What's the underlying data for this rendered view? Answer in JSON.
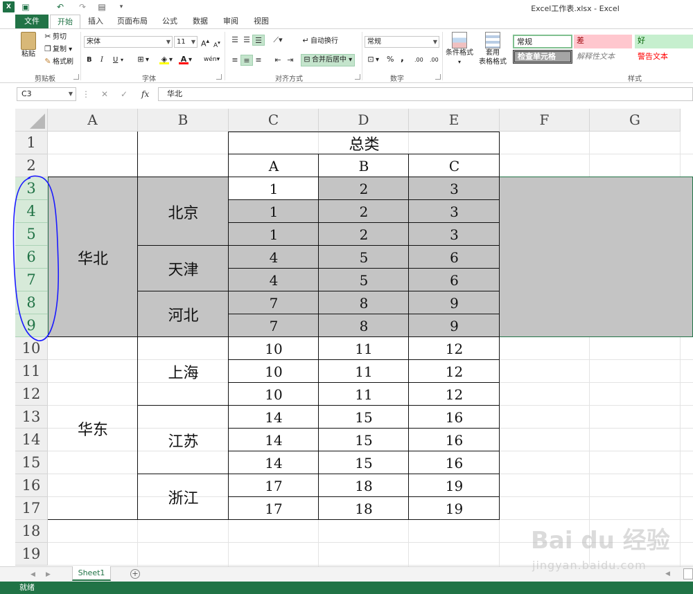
{
  "window_title": "Excel工作表.xlsx - Excel",
  "logo_text": "X",
  "quick_access": [
    "save-icon",
    "undo-icon",
    "redo-icon",
    "touch-mode-icon"
  ],
  "tabs": [
    "文件",
    "开始",
    "插入",
    "页面布局",
    "公式",
    "数据",
    "审阅",
    "视图"
  ],
  "active_tab": "开始",
  "ribbon": {
    "clipboard": {
      "label": "剪贴板",
      "paste": "粘贴",
      "cut": "剪切",
      "copy": "复制",
      "format_painter": "格式刷"
    },
    "font": {
      "label": "字体",
      "name": "宋体",
      "size": "11",
      "grow": "A",
      "shrink": "A",
      "bold": "B",
      "italic": "I",
      "underline": "U",
      "phonetic": "wén"
    },
    "alignment": {
      "label": "对齐方式",
      "wrap": "自动换行",
      "merge": "合并后居中"
    },
    "number": {
      "label": "数字",
      "format": "常规",
      "percent": "%",
      "comma": ",",
      "inc_decimal": ".00",
      "dec_decimal": ".00"
    },
    "styles_group": {
      "label": "样式",
      "conditional": "条件格式",
      "table": "套用",
      "table2": "表格格式"
    },
    "styles": [
      {
        "name": "常规",
        "bg": "#ffffff",
        "fg": "#000000"
      },
      {
        "name": "差",
        "bg": "#ffc7ce",
        "fg": "#9c0006"
      },
      {
        "name": "好",
        "bg": "#c6efce",
        "fg": "#006100"
      },
      {
        "name": "检查单元格",
        "bg": "#a5a5a5",
        "fg": "#ffffff"
      },
      {
        "name": "解释性文本",
        "bg": "#ffffff",
        "fg": "#7f7f7f"
      },
      {
        "name": "警告文本",
        "bg": "#ffffff",
        "fg": "#ff0000"
      }
    ]
  },
  "formula_bar": {
    "name_box": "C3",
    "cancel": "✕",
    "enter": "✓",
    "fx": "fx",
    "content": "华北"
  },
  "columns": [
    "A",
    "B",
    "C",
    "D",
    "E",
    "F",
    "G"
  ],
  "rows": [
    "1",
    "2",
    "3",
    "4",
    "5",
    "6",
    "7",
    "8",
    "9",
    "10",
    "11",
    "12",
    "13",
    "14",
    "15",
    "16",
    "17",
    "18",
    "19"
  ],
  "selected_rows": [
    "3",
    "4",
    "5",
    "6",
    "7",
    "8",
    "9"
  ],
  "sheet": {
    "header_title": "总类",
    "sub_headers": [
      "A",
      "B",
      "C"
    ],
    "regions": [
      {
        "name": "华北",
        "cities": [
          {
            "name": "北京",
            "rows": [
              [
                "1",
                "2",
                "3"
              ],
              [
                "1",
                "2",
                "3"
              ],
              [
                "1",
                "2",
                "3"
              ]
            ]
          },
          {
            "name": "天津",
            "rows": [
              [
                "4",
                "5",
                "6"
              ],
              [
                "4",
                "5",
                "6"
              ]
            ]
          },
          {
            "name": "河北",
            "rows": [
              [
                "7",
                "8",
                "9"
              ],
              [
                "7",
                "8",
                "9"
              ]
            ]
          }
        ]
      },
      {
        "name": "华东",
        "cities": [
          {
            "name": "上海",
            "rows": [
              [
                "10",
                "11",
                "12"
              ],
              [
                "10",
                "11",
                "12"
              ],
              [
                "10",
                "11",
                "12"
              ]
            ]
          },
          {
            "name": "江苏",
            "rows": [
              [
                "14",
                "15",
                "16"
              ],
              [
                "14",
                "15",
                "16"
              ],
              [
                "14",
                "15",
                "16"
              ]
            ]
          },
          {
            "name": "浙江",
            "rows": [
              [
                "17",
                "18",
                "19"
              ],
              [
                "17",
                "18",
                "19"
              ]
            ]
          }
        ]
      }
    ]
  },
  "sheet_tabs": [
    "Sheet1"
  ],
  "add_sheet": "+",
  "status": "就绪",
  "watermark": {
    "brand": "Bai du 经验",
    "url": "jingyan.baidu.com"
  },
  "colors": {
    "accent": "#217346",
    "selection": "#c4c4c4",
    "annotation": "#1a1aff"
  }
}
